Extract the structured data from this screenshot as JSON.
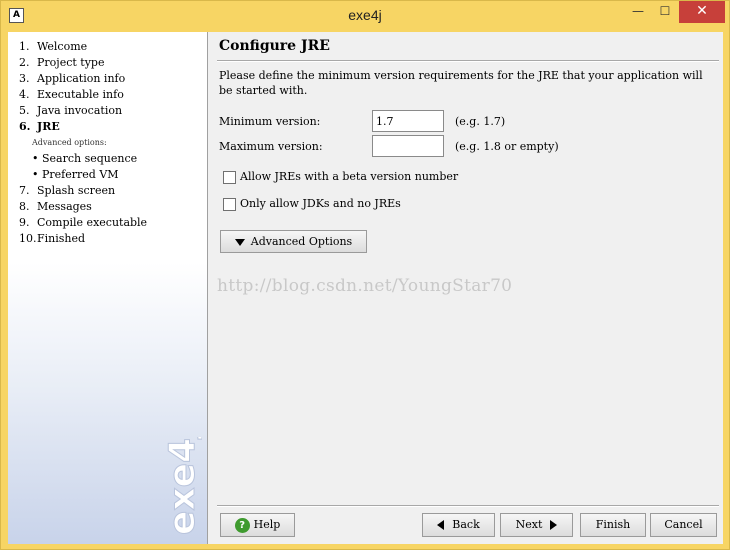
{
  "window": {
    "title": "exe4j",
    "icon_letter": "A",
    "minimize_glyph": "—",
    "maximize_glyph": "☐",
    "close_glyph": "✕"
  },
  "sidebar": {
    "steps": [
      {
        "num": "1.",
        "label": "Welcome"
      },
      {
        "num": "2.",
        "label": "Project type"
      },
      {
        "num": "3.",
        "label": "Application info"
      },
      {
        "num": "4.",
        "label": "Executable info"
      },
      {
        "num": "5.",
        "label": "Java invocation"
      },
      {
        "num": "6.",
        "label": "JRE"
      },
      {
        "num": "7.",
        "label": "Splash screen"
      },
      {
        "num": "8.",
        "label": "Messages"
      },
      {
        "num": "9.",
        "label": "Compile executable"
      },
      {
        "num": "10.",
        "label": "Finished"
      }
    ],
    "advanced_heading": "Advanced options:",
    "sub_steps": [
      {
        "bullet": "•",
        "label": "Search sequence"
      },
      {
        "bullet": "•",
        "label": "Preferred VM"
      }
    ],
    "brand_text": "exe4j"
  },
  "main": {
    "title": "Configure JRE",
    "description": "Please define the minimum version requirements for the JRE that your application will be started with.",
    "min_version_label": "Minimum version:",
    "min_version_value": "1.7",
    "min_version_hint": "(e.g. 1.7)",
    "max_version_label": "Maximum version:",
    "max_version_value": "",
    "max_version_hint": "(e.g. 1.8 or empty)",
    "allow_beta_label": "Allow JREs with a beta version number",
    "allow_beta_checked": false,
    "only_jdk_label": "Only allow JDKs and no JREs",
    "only_jdk_checked": false,
    "advanced_button": "Advanced Options",
    "watermark": "http://blog.csdn.net/YoungStar70"
  },
  "buttons": {
    "help": "Help",
    "back": "Back",
    "next": "Next",
    "finish": "Finish",
    "cancel": "Cancel"
  },
  "colors": {
    "titlebar": "#f7d564",
    "close_button": "#c7403a",
    "help_icon": "#3f9b2f"
  }
}
